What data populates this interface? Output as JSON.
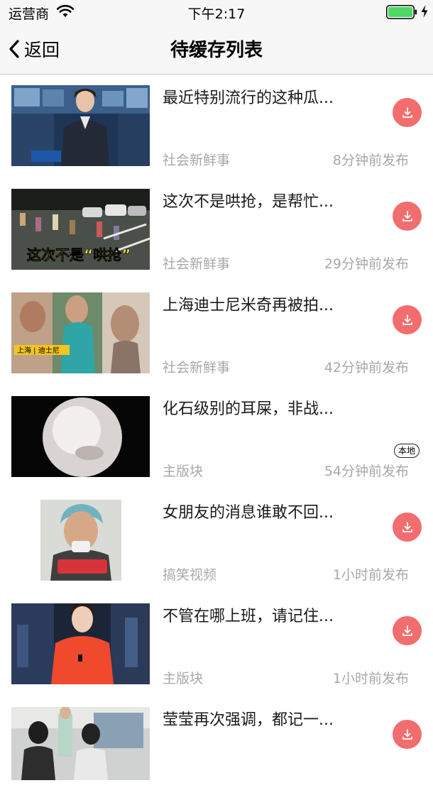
{
  "status_bar": {
    "carrier": "运营商",
    "time": "下午2:17"
  },
  "nav": {
    "back_label": "返回",
    "title": "待缓存列表"
  },
  "items": [
    {
      "title": "最近特别流行的这种瓜...",
      "category": "社会新鲜事",
      "time": "8分钟前发布",
      "action": "download"
    },
    {
      "title": "这次不是哄抢，是帮忙...",
      "category": "社会新鲜事",
      "time": "29分钟前发布",
      "action": "download"
    },
    {
      "title": "上海迪士尼米奇再被拍...",
      "category": "社会新鲜事",
      "time": "42分钟前发布",
      "action": "download"
    },
    {
      "title": "化石级别的耳屎，非战...",
      "category": "主版块",
      "time": "54分钟前发布",
      "action": "local",
      "badge": "本地"
    },
    {
      "title": "女朋友的消息谁敢不回...",
      "category": "搞笑视频",
      "time": "1小时前发布",
      "action": "download"
    },
    {
      "title": "不管在哪上班，请记住...",
      "category": "主版块",
      "time": "1小时前发布",
      "action": "download"
    },
    {
      "title": "莹莹再次强调，都记一...",
      "category": "",
      "time": "",
      "action": "download"
    }
  ],
  "thumb_texts": {
    "item2_caption": "这次不是“哄抢”",
    "item3_tag": "上海 | 迪士尼"
  },
  "colors": {
    "accent": "#f26d6d",
    "battery": "#4cd964",
    "secondary_text": "#a8a8a8"
  }
}
